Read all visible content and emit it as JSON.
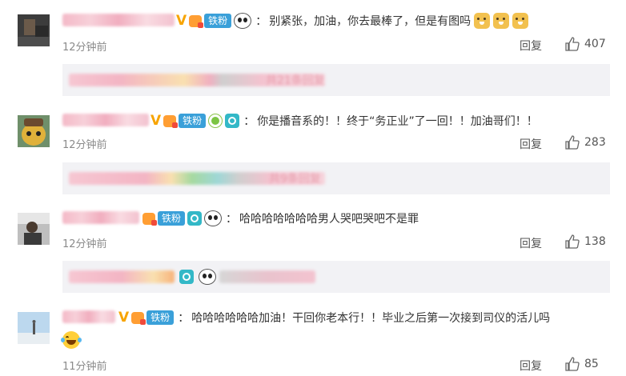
{
  "labels": {
    "colon": "：",
    "reply": "回复",
    "tiefen": "铁粉",
    "vbadge": "V"
  },
  "comments": [
    {
      "text": "别紧张，加油，你去最棒了，但是有图吗",
      "time": "12分钟前",
      "likes": "407",
      "sub_preview": "共21条回复"
    },
    {
      "text": "你是播音系的！！终于“务正业”了一回！！加油哥们！！",
      "time": "12分钟前",
      "likes": "283",
      "sub_preview": "共9条回复"
    },
    {
      "text": "哈哈哈哈哈哈哈男人哭吧哭吧不是罪",
      "time": "12分钟前",
      "likes": "138"
    },
    {
      "text": "哈哈哈哈哈哈加油！干回你老本行！！毕业之后第一次接到司仪的活儿吗",
      "time": "11分钟前",
      "likes": "85"
    }
  ],
  "colors": {
    "tiefen_badge": "#3aa0d9",
    "v_badge": "#f7a400",
    "meta_text": "#8a8a8a",
    "subreply_bg": "#f2f2f5"
  },
  "icons": [
    "thumb-up-icon",
    "panda-emoji-icon",
    "doge-emoji-icon",
    "camera-badge-icon",
    "crown-badge-icon",
    "laugh-cry-emoji-icon"
  ]
}
